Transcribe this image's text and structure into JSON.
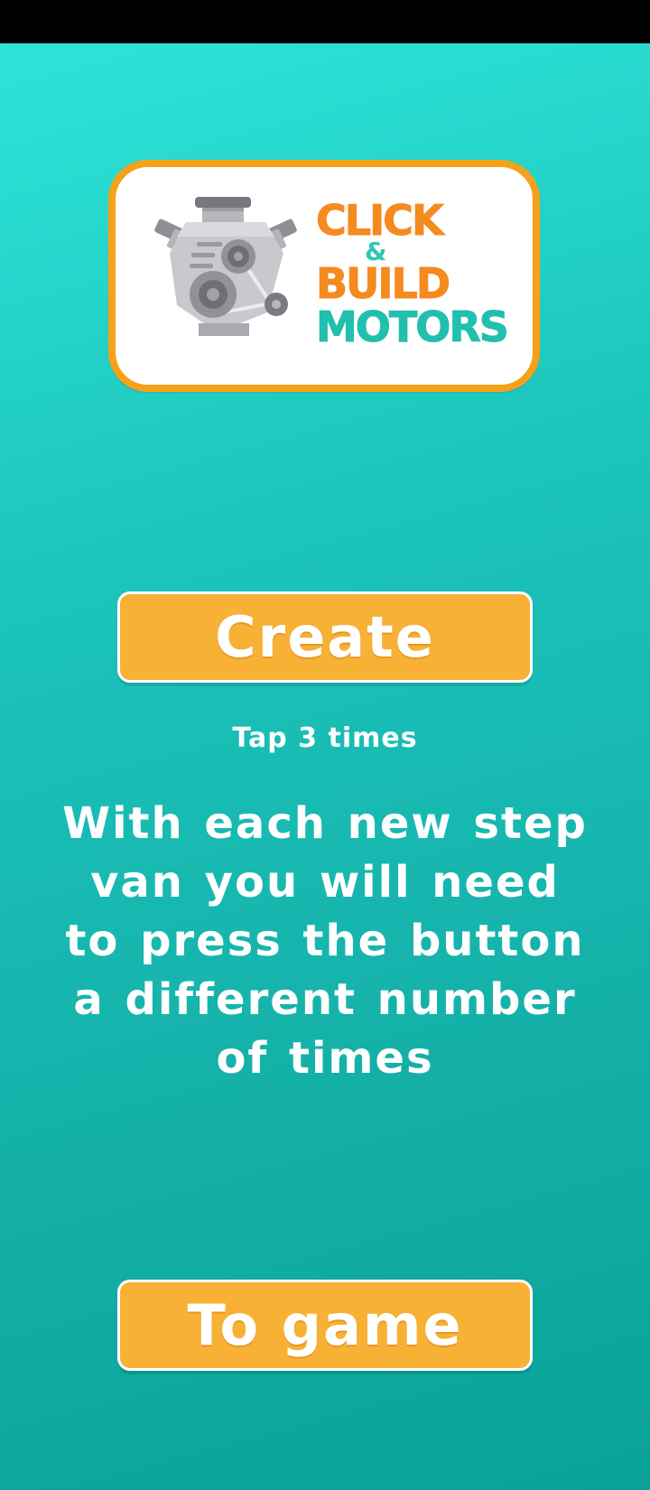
{
  "logo": {
    "line1": "CLICK",
    "amp": "&",
    "line2": "BUILD",
    "line3": "MOTORS",
    "icon": "engine-icon"
  },
  "create_button": {
    "label": "Create"
  },
  "tap_hint": "Tap 3 times",
  "instruction": "With each new step van you will need to press the button a different number of times",
  "to_game_button": {
    "label": "To game"
  },
  "colors": {
    "background_top": "#2ee3d8",
    "background_bottom": "#0aa298",
    "button_fill": "#f7b135",
    "logo_border": "#f6a117",
    "logo_orange": "#f58a1f",
    "logo_teal": "#21bfae"
  }
}
